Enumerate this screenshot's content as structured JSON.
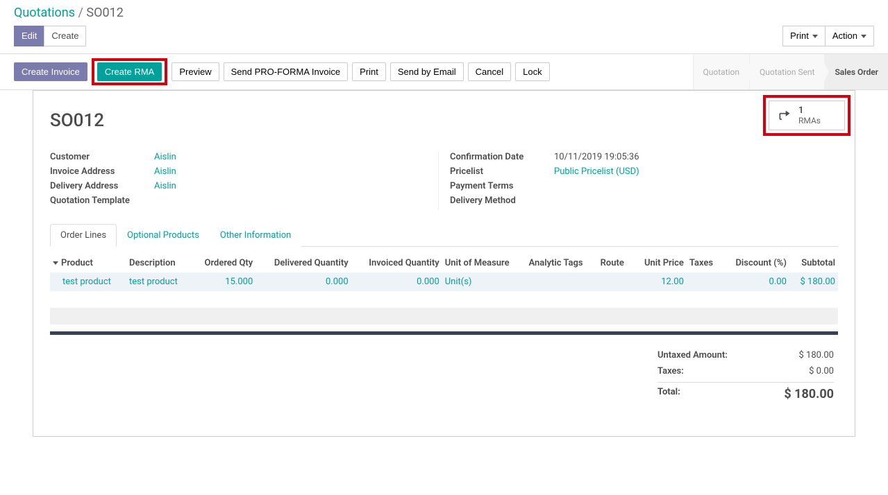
{
  "breadcrumb": {
    "root": "Quotations",
    "current": "SO012"
  },
  "toolbar": {
    "edit": "Edit",
    "create": "Create",
    "print": "Print",
    "action": "Action"
  },
  "actions": {
    "create_invoice": "Create Invoice",
    "create_rma": "Create RMA",
    "preview": "Preview",
    "send_proforma": "Send PRO-FORMA Invoice",
    "print": "Print",
    "send_email": "Send by Email",
    "cancel": "Cancel",
    "lock": "Lock"
  },
  "status": {
    "quotation": "Quotation",
    "quotation_sent": "Quotation Sent",
    "sales_order": "Sales Order"
  },
  "stat": {
    "count": "1",
    "label": "RMAs"
  },
  "record": {
    "name": "SO012",
    "customer_label": "Customer",
    "customer": "Aislin",
    "invoice_addr_label": "Invoice Address",
    "invoice_addr": "Aislin",
    "delivery_addr_label": "Delivery Address",
    "delivery_addr": "Aislin",
    "quotation_tpl_label": "Quotation Template",
    "quotation_tpl": "",
    "confirm_date_label": "Confirmation Date",
    "confirm_date": "10/11/2019 19:05:36",
    "pricelist_label": "Pricelist",
    "pricelist": "Public Pricelist (USD)",
    "payment_terms_label": "Payment Terms",
    "payment_terms": "",
    "delivery_method_label": "Delivery Method",
    "delivery_method": ""
  },
  "tabs": {
    "order_lines": "Order Lines",
    "optional_products": "Optional Products",
    "other_info": "Other Information"
  },
  "columns": {
    "product": "Product",
    "description": "Description",
    "ordered_qty": "Ordered Qty",
    "delivered_qty": "Delivered Quantity",
    "invoiced_qty": "Invoiced Quantity",
    "uom": "Unit of Measure",
    "analytic_tags": "Analytic Tags",
    "route": "Route",
    "unit_price": "Unit Price",
    "taxes": "Taxes",
    "discount": "Discount (%)",
    "subtotal": "Subtotal"
  },
  "lines": [
    {
      "product": "test product",
      "description": "test product",
      "ordered_qty": "15.000",
      "delivered_qty": "0.000",
      "invoiced_qty": "0.000",
      "uom": "Unit(s)",
      "analytic_tags": "",
      "route": "",
      "unit_price": "12.00",
      "taxes": "",
      "discount": "0.00",
      "subtotal": "$ 180.00"
    }
  ],
  "totals": {
    "untaxed_label": "Untaxed Amount:",
    "untaxed": "$ 180.00",
    "taxes_label": "Taxes:",
    "taxes": "$ 0.00",
    "total_label": "Total:",
    "total": "$ 180.00"
  }
}
